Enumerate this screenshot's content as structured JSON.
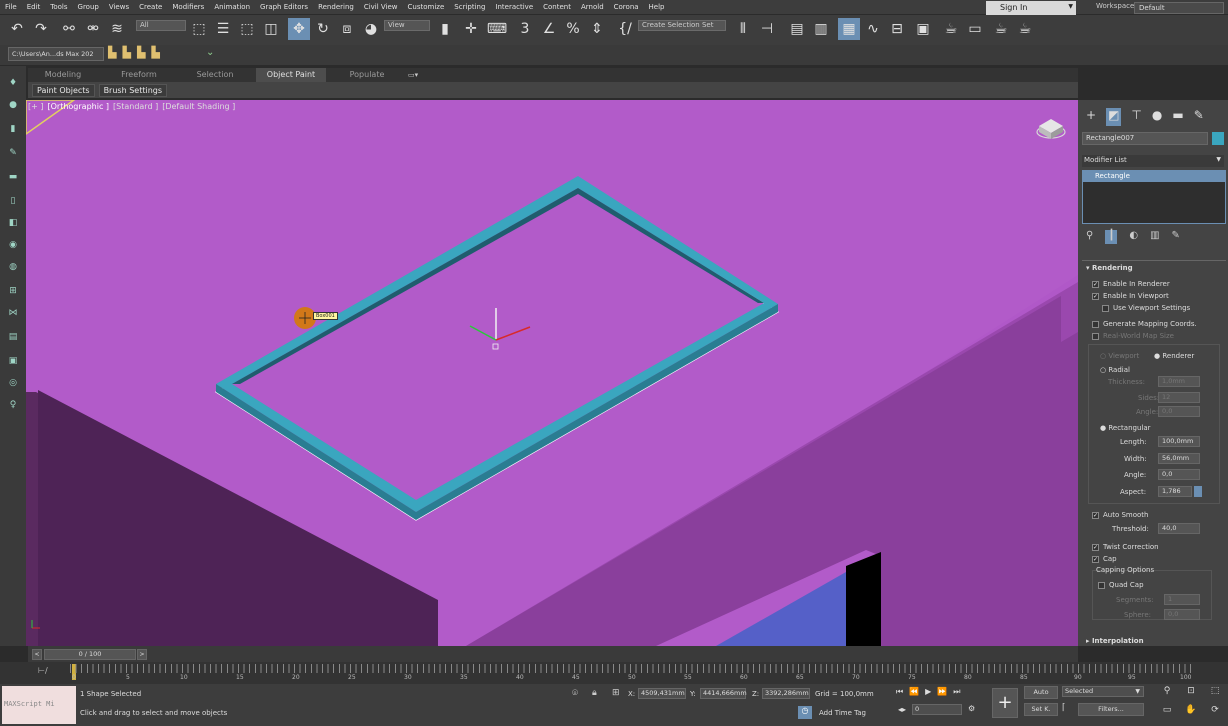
{
  "menubar": {
    "items": [
      "File",
      "Edit",
      "Tools",
      "Group",
      "Views",
      "Create",
      "Modifiers",
      "Animation",
      "Graph Editors",
      "Rendering",
      "Civil View",
      "Customize",
      "Scripting",
      "Interactive",
      "Content",
      "Arnold",
      "Corona",
      "Help"
    ],
    "sign_in": "Sign In",
    "workspaces_label": "Workspaces:",
    "workspace_value": "Default"
  },
  "toolbar": {
    "filter_all": "All",
    "view_combo": "View",
    "selection_set": "Create Selection Set"
  },
  "project_path": "C:\\Users\\An...ds Max 202",
  "ribbon": {
    "tabs": [
      "Modeling",
      "Freeform",
      "Selection",
      "Object Paint",
      "Populate"
    ],
    "active_tab": "Object Paint",
    "subtabs": [
      "Paint Objects",
      "Brush Settings"
    ]
  },
  "viewport": {
    "label_plus": "[+ ]",
    "label_view": "[Orthographic ]",
    "label_standard": "[Standard ]",
    "label_shading": "[Default Shading ]",
    "cursor_tooltip": "Box001"
  },
  "command_panel": {
    "object_name": "Rectangle007",
    "modifier_list": "Modifier List",
    "stack_item": "Rectangle",
    "rendering_title": "Rendering",
    "enable_in_renderer": "Enable In Renderer",
    "enable_in_viewport": "Enable In Viewport",
    "use_viewport_settings": "Use Viewport Settings",
    "generate_mapping": "Generate Mapping Coords.",
    "real_world_map": "Real-World Map Size",
    "viewport_radio": "Viewport",
    "renderer_radio": "Renderer",
    "radial": "Radial",
    "thickness_label": "Thickness:",
    "thickness_value": "1,0mm",
    "sides_label": "Sides:",
    "sides_value": "12",
    "angle_label_radial": "Angle:",
    "angle_value_radial": "0,0",
    "rectangular": "Rectangular",
    "length_label": "Length:",
    "length_value": "100,0mm",
    "width_label": "Width:",
    "width_value": "56,0mm",
    "angle_label": "Angle:",
    "angle_value": "0,0",
    "aspect_label": "Aspect:",
    "aspect_value": "1,786",
    "auto_smooth": "Auto Smooth",
    "threshold_label": "Threshold:",
    "threshold_value": "40,0",
    "twist_correction": "Twist Correction",
    "cap": "Cap",
    "capping_options": "Capping Options",
    "quad_cap": "Quad Cap",
    "segments_label": "Segments:",
    "segments_value": "1",
    "sphere_label": "Sphere:",
    "sphere_value": "0,0",
    "interpolation": "Interpolation"
  },
  "timeline": {
    "frame_display": "0 / 100",
    "ticks": [
      "0",
      "5",
      "10",
      "15",
      "20",
      "25",
      "30",
      "35",
      "40",
      "45",
      "50",
      "55",
      "60",
      "65",
      "70",
      "75",
      "80",
      "85",
      "90",
      "95",
      "100"
    ]
  },
  "status": {
    "maxscript": "MAXScript Mi",
    "selection": "1 Shape Selected",
    "prompt": "Click and drag to select and move objects",
    "x_label": "X:",
    "x_value": "4509,431mm",
    "y_label": "Y:",
    "y_value": "4414,666mm",
    "z_label": "Z:",
    "z_value": "3392,286mm",
    "grid": "Grid = 100,0mm",
    "add_time_tag": "Add Time Tag",
    "auto_key": "Auto",
    "set_key": "Set K.",
    "selected_combo": "Selected",
    "filters": "Filters...",
    "frame_value": "0"
  }
}
